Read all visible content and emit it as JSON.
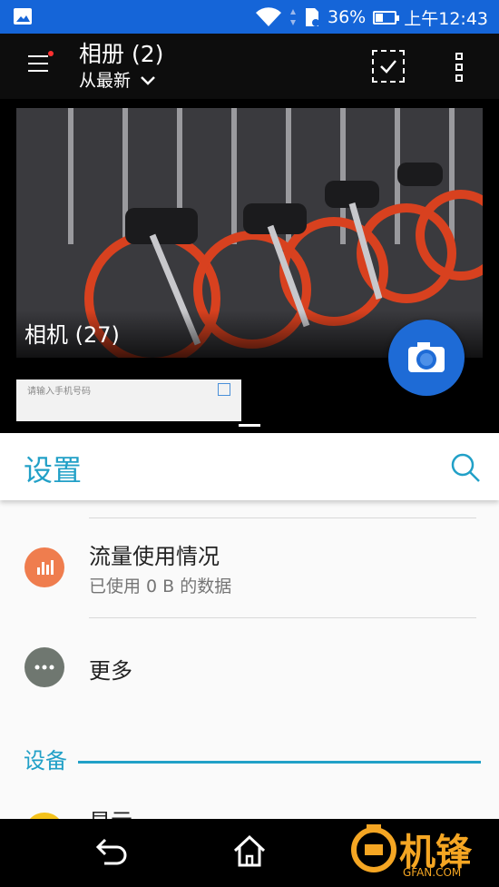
{
  "status_bar": {
    "battery": "36%",
    "battery_level": 0.36,
    "time": "上午12:43"
  },
  "gallery": {
    "title": "相册 (2)",
    "sort": "从最新",
    "album_name": "相机 (27)",
    "ad_placeholder": "请输入手机号码"
  },
  "settings": {
    "title": "设置",
    "items": [
      {
        "title": "流量使用情况",
        "subtitle": "已使用 0 B 的数据",
        "icon": "data-usage-icon",
        "color": "#ef7d4e"
      },
      {
        "title": "更多",
        "icon": "more-horiz-icon",
        "color": "#6f7770"
      }
    ],
    "section": "设备",
    "partial_item": "显示",
    "accent": "#21a0c7"
  },
  "watermark": {
    "text": "机锋",
    "sub": "GFAN.COM"
  }
}
